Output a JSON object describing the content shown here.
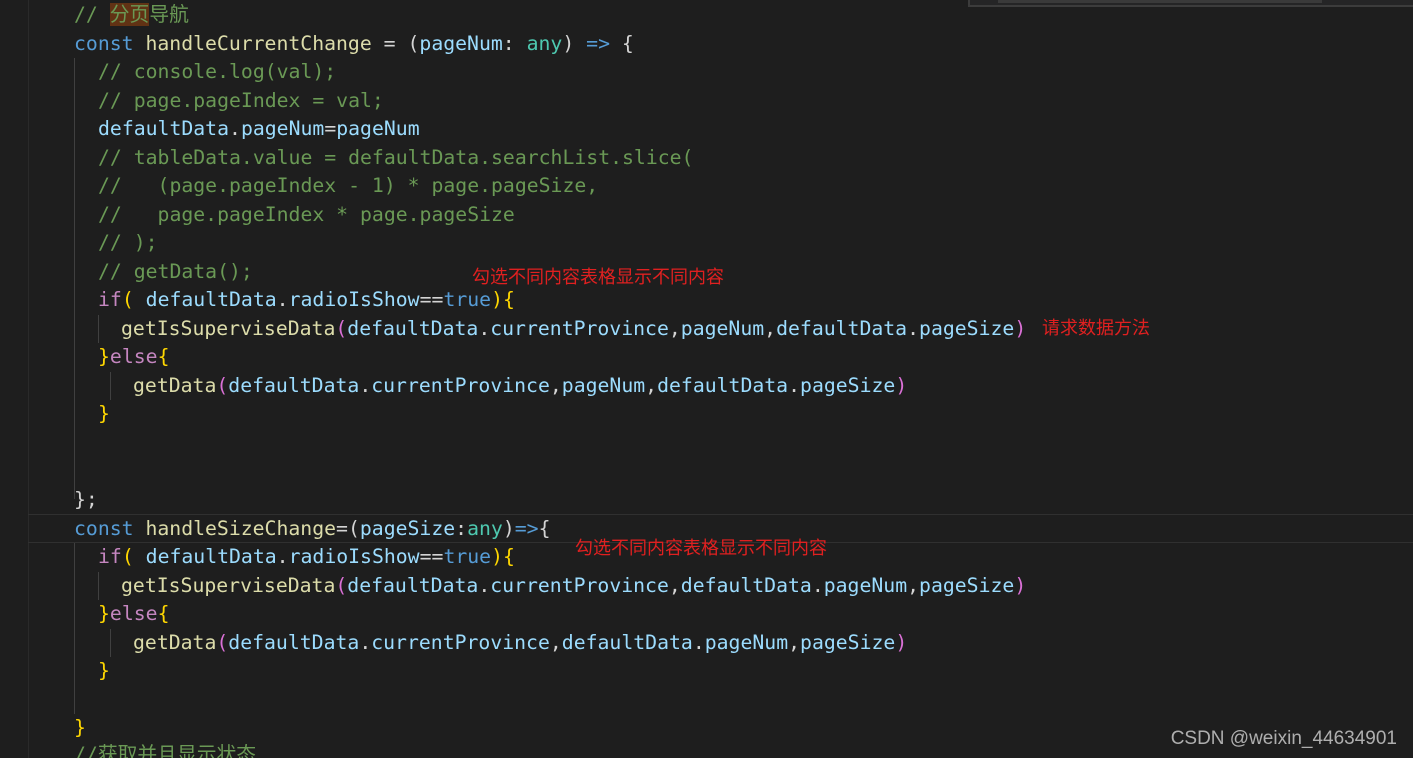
{
  "code": {
    "l0": {
      "comment_prefix": "// ",
      "highlight": "分页",
      "comment_rest": "导航"
    },
    "l1": {
      "kw": "const",
      "fn": "handleCurrentChange",
      "op": " = ",
      "p1": "(",
      "param": "pageNum",
      "colon": ": ",
      "type": "any",
      "p2": ")",
      "arrow": " => ",
      "brace": "{"
    },
    "l2": {
      "comment": "// console.log(val);"
    },
    "l3": {
      "comment": "// page.pageIndex = val;"
    },
    "l4": {
      "obj": "defaultData",
      "dot": ".",
      "prop": "pageNum",
      "eq": "=",
      "val": "pageNum"
    },
    "l5": {
      "comment": "// tableData.value = defaultData.searchList.slice("
    },
    "l6": {
      "comment": "//   (page.pageIndex - 1) * page.pageSize,"
    },
    "l7": {
      "comment": "//   page.pageIndex * page.pageSize"
    },
    "l8": {
      "comment": "// );"
    },
    "l9": {
      "comment": "// getData();"
    },
    "l10": {
      "kw": "if",
      "p1": "( ",
      "obj": "defaultData",
      "dot": ".",
      "prop": "radioIsShow",
      "eq": "==",
      "bool": "true",
      "p2": ")",
      "brace": "{"
    },
    "l11": {
      "fn": "getIsSuperviseData",
      "p1": "(",
      "a1": "defaultData",
      "d1": ".",
      "a2": "currentProvince",
      "c1": ",",
      "a3": "pageNum",
      "c2": ",",
      "a4": "defaultData",
      "d2": ".",
      "a5": "pageSize",
      "p2": ")"
    },
    "l12": {
      "brace1": "}",
      "kw": "else",
      "brace2": "{"
    },
    "l13": {
      "fn": "getData",
      "p1": "(",
      "a1": "defaultData",
      "d1": ".",
      "a2": "currentProvince",
      "c1": ",",
      "a3": "pageNum",
      "c2": ",",
      "a4": "defaultData",
      "d2": ".",
      "a5": "pageSize",
      "p2": ")"
    },
    "l14": {
      "brace": "}"
    },
    "l17": {
      "brace": "}",
      "semi": ";"
    },
    "l18": {
      "kw": "const",
      "fn": "handleSizeChange",
      "eq": "=",
      "p1": "(",
      "param": "pageSize",
      "colon": ":",
      "type": "any",
      "p2": ")",
      "arrow": "=>",
      "brace": "{"
    },
    "l19": {
      "kw": "if",
      "p1": "( ",
      "obj": "defaultData",
      "dot": ".",
      "prop": "radioIsShow",
      "eq": "==",
      "bool": "true",
      "p2": ")",
      "brace": "{"
    },
    "l20": {
      "fn": "getIsSuperviseData",
      "p1": "(",
      "a1": "defaultData",
      "d1": ".",
      "a2": "currentProvince",
      "c1": ",",
      "a3": "defaultData",
      "d2": ".",
      "a4": "pageNum",
      "c2": ",",
      "a5": "pageSize",
      "p2": ")"
    },
    "l21": {
      "brace1": "}",
      "kw": "else",
      "brace2": "{"
    },
    "l22": {
      "fn": "getData",
      "p1": "(",
      "a1": "defaultData",
      "d1": ".",
      "a2": "currentProvince",
      "c1": ",",
      "a3": "defaultData",
      "d2": ".",
      "a4": "pageNum",
      "c2": ",",
      "a5": "pageSize",
      "p2": ")"
    },
    "l23": {
      "brace": "}"
    },
    "l25": {
      "brace": "}"
    },
    "l26": {
      "comment": "//获取并且显示状态"
    }
  },
  "annotations": {
    "note1": "勾选不同内容表格显示不同内容",
    "note2": "请求数据方法",
    "note3": "勾选不同内容表格显示不同内容"
  },
  "watermark": "CSDN @weixin_44634901",
  "colors": {
    "background": "#1e1e1e",
    "keyword": "#569cd6",
    "control": "#c586c0",
    "function": "#dcdcaa",
    "variable": "#9cdcfe",
    "type": "#4ec9b0",
    "comment": "#6a9955",
    "annotation": "#e02020"
  }
}
